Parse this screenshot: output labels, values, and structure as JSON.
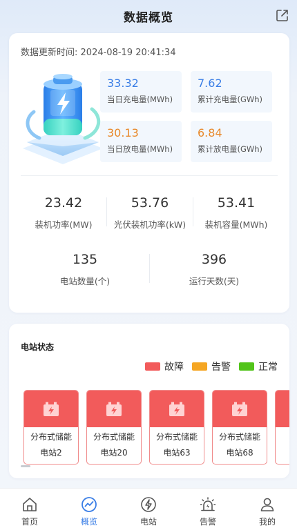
{
  "header": {
    "title": "数据概览"
  },
  "update": {
    "label": "数据更新时间:",
    "time": "2024-08-19 20:41:34"
  },
  "energy": [
    {
      "value": "33.32",
      "label": "当日充电量(MWh)",
      "color": "#3a7ee6"
    },
    {
      "value": "7.62",
      "label": "累计充电量(GWh)",
      "color": "#3a7ee6"
    },
    {
      "value": "30.13",
      "label": "当日放电量(MWh)",
      "color": "#e8892b"
    },
    {
      "value": "6.84",
      "label": "累计放电量(GWh)",
      "color": "#e8892b"
    }
  ],
  "metrics_row1": [
    {
      "value": "23.42",
      "label": "装机功率(MW)"
    },
    {
      "value": "53.76",
      "label": "光伏装机功率(kW)"
    },
    {
      "value": "53.41",
      "label": "装机容量(MWh)"
    }
  ],
  "metrics_row2": [
    {
      "value": "135",
      "label": "电站数量(个)"
    },
    {
      "value": "396",
      "label": "运行天数(天)"
    }
  ],
  "station_status": {
    "title": "电站状态",
    "legend": [
      {
        "label": "故障",
        "color": "#f25b5b"
      },
      {
        "label": "告警",
        "color": "#f5a623"
      },
      {
        "label": "正常",
        "color": "#52c41a"
      }
    ],
    "stations": [
      {
        "line1": "分布式储能",
        "line2": "电站2",
        "status": "故障"
      },
      {
        "line1": "分布式储能",
        "line2": "电站20",
        "status": "故障"
      },
      {
        "line1": "分布式储能",
        "line2": "电站63",
        "status": "故障"
      },
      {
        "line1": "分布式储能",
        "line2": "电站68",
        "status": "故障"
      }
    ]
  },
  "tabs": [
    {
      "label": "首页",
      "icon": "home-icon"
    },
    {
      "label": "概览",
      "icon": "chart-icon",
      "active": true
    },
    {
      "label": "电站",
      "icon": "station-icon"
    },
    {
      "label": "告警",
      "icon": "alarm-icon"
    },
    {
      "label": "我的",
      "icon": "user-icon"
    }
  ]
}
